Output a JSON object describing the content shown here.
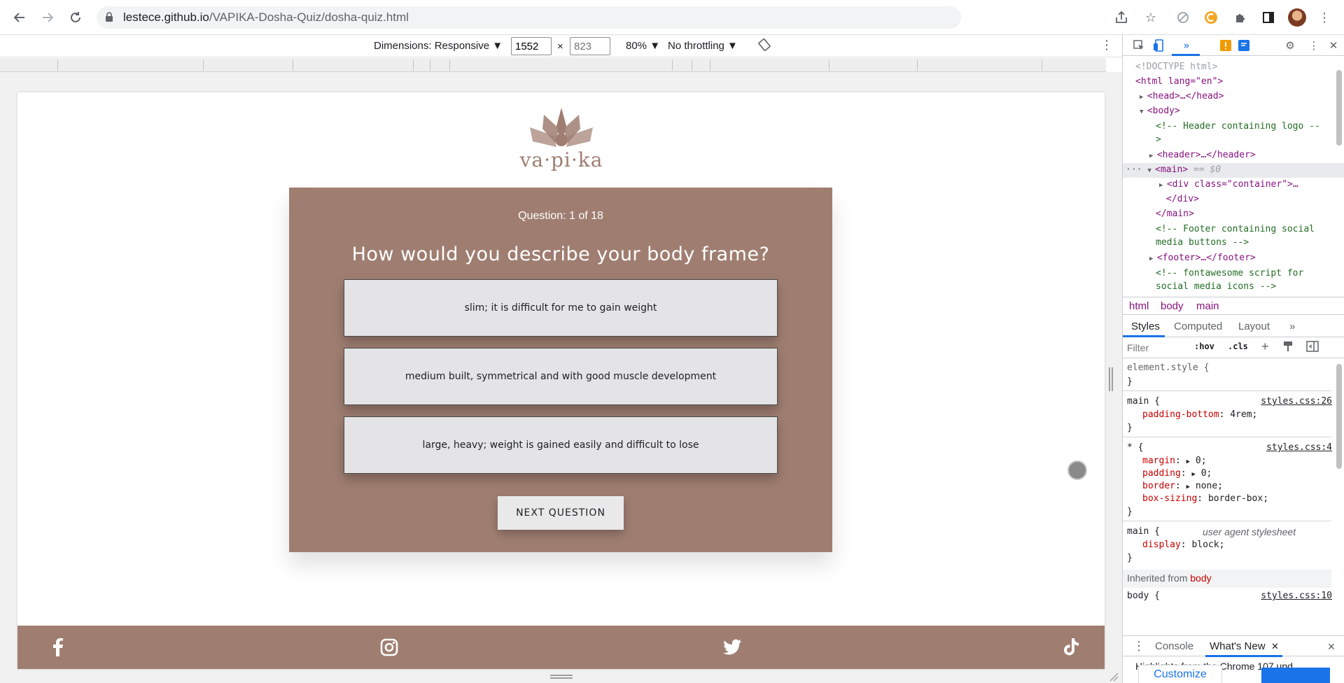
{
  "browser": {
    "url_domain": "lestece.github.io",
    "url_path": "/VAPIKA-Dosha-Quiz/dosha-quiz.html"
  },
  "device_toolbar": {
    "dimensions_label": "Dimensions: Responsive ▼",
    "width_value": "1552",
    "height_placeholder": "823",
    "times": "×",
    "zoom_label": "80% ▼",
    "throttling_label": "No throttling ▼"
  },
  "page": {
    "logo_text": "va·pi·ka",
    "question_counter": "Question: 1 of 18",
    "question": "How would you describe your body frame?",
    "answers": [
      "slim; it is difficult for me to gain weight",
      "medium built, symmetrical and with good muscle development",
      "large, heavy; weight is gained easily and difficult to lose"
    ],
    "next_button": "NEXT QUESTION",
    "brand_color": "#9f7e71",
    "social": [
      "facebook-icon",
      "instagram-icon",
      "twitter-icon",
      "tiktok-icon"
    ]
  },
  "devtools": {
    "elements": [
      {
        "text": "<!DOCTYPE html>"
      },
      {
        "text": "<html lang=\"en\">"
      },
      {
        "text": "<head>…</head>"
      },
      {
        "text": "<body>"
      },
      {
        "text": "<!-- Header containing logo --"
      },
      {
        "text": ">"
      },
      {
        "text": "<header>…</header>"
      },
      {
        "text": "<main>"
      },
      {
        "text": "== $0"
      },
      {
        "text": "<div class=\"container\">…"
      },
      {
        "text": "</div>"
      },
      {
        "text": "</main>"
      },
      {
        "text": "<!-- Footer containing social"
      },
      {
        "text": "media buttons -->"
      },
      {
        "text": "<footer>…</footer>"
      },
      {
        "text": "<!-- fontawesome script for"
      },
      {
        "text": "social media icons -->"
      }
    ],
    "breadcrumbs": [
      "html",
      "body",
      "main"
    ],
    "sub_tabs": [
      "Styles",
      "Computed",
      "Layout",
      "»"
    ],
    "filter_placeholder": "Filter",
    "hov": ":hov",
    "cls": ".cls",
    "styles": {
      "element_style": "element.style {",
      "close": "}",
      "rule1_selector": "main {",
      "rule1_source": "styles.css:26",
      "rule1_prop": "padding-bottom",
      "rule1_value": "4rem;",
      "rule2_selector": "* {",
      "rule2_source": "styles.css:4",
      "rule2_props": [
        {
          "name": "margin",
          "value": "0;"
        },
        {
          "name": "padding",
          "value": "0;"
        },
        {
          "name": "border",
          "value": "none;"
        },
        {
          "name": "box-sizing",
          "value": "border-box;"
        }
      ],
      "rule3_selector": "main {",
      "rule3_source": "user agent stylesheet",
      "rule3_prop": "display",
      "rule3_value": "block;",
      "inherited_label": "Inherited from",
      "inherited_from": "body",
      "body_partial": "body {",
      "body_partial_src": "styles.css:10"
    },
    "drawer": {
      "console_tab": "Console",
      "whats_new_tab": "What's New",
      "highlights": "Highlights from the Chrome 107 upd…",
      "customize": "Customize"
    }
  }
}
